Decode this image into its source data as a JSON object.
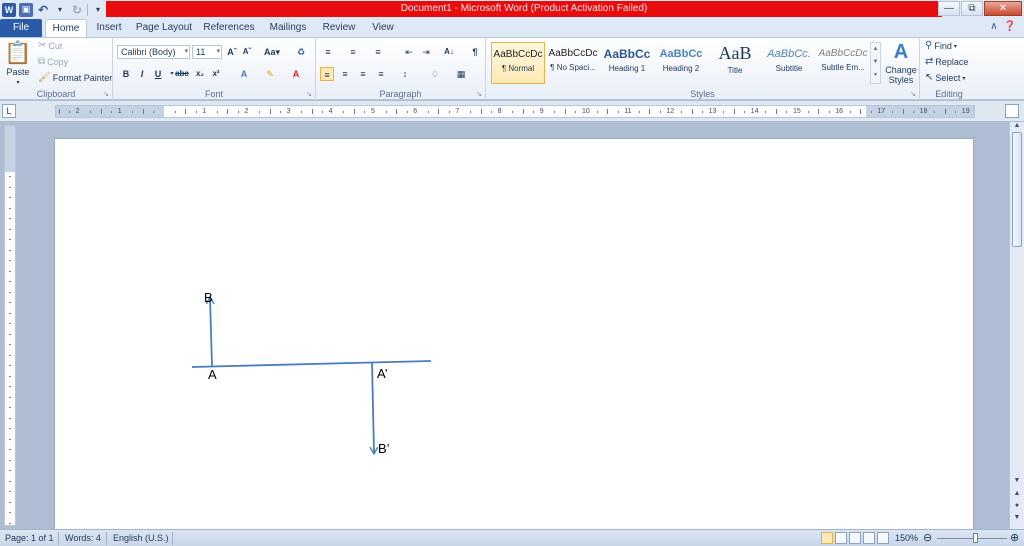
{
  "window": {
    "title": "Document1 - Microsoft Word (Product Activation Failed)",
    "controls": {
      "minimize": "—",
      "restore": "⧉",
      "close": "✕"
    }
  },
  "qat": {
    "app_letter": "W"
  },
  "tabs": [
    "File",
    "Home",
    "Insert",
    "Page Layout",
    "References",
    "Mailings",
    "Review",
    "View"
  ],
  "ribbon": {
    "clipboard": {
      "label": "Clipboard",
      "paste": "Paste",
      "cut": "Cut",
      "copy": "Copy",
      "format_painter": "Format Painter"
    },
    "font": {
      "label": "Font",
      "font_name": "Calibri (Body)",
      "font_size": "11"
    },
    "paragraph": {
      "label": "Paragraph"
    },
    "styles": {
      "label": "Styles",
      "items": [
        {
          "sample": "AaBbCcDc",
          "name": "¶ Normal"
        },
        {
          "sample": "AaBbCcDc",
          "name": "¶ No Spaci..."
        },
        {
          "sample": "AaBbCc",
          "name": "Heading 1"
        },
        {
          "sample": "AaBbCc",
          "name": "Heading 2"
        },
        {
          "sample": "AaB",
          "name": "Title"
        },
        {
          "sample": "AaBbCc.",
          "name": "Subtitle"
        },
        {
          "sample": "AaBbCcDc",
          "name": "Subtle Em..."
        }
      ],
      "change_styles": "Change Styles"
    },
    "editing": {
      "label": "Editing",
      "find": "Find",
      "replace": "Replace",
      "select": "Select"
    }
  },
  "ruler": {
    "tab_selector": "L",
    "numbers": [
      "2",
      "1",
      "1",
      "1",
      "2",
      "3",
      "4",
      "5",
      "6",
      "7",
      "8",
      "9",
      "10",
      "11",
      "12",
      "13",
      "14",
      "15",
      "16",
      "17",
      "18",
      "19"
    ]
  },
  "document": {
    "labels": {
      "B": "B",
      "A": "A",
      "A_prime": "A’",
      "B_prime": "B’"
    }
  },
  "statusbar": {
    "page": "Page: 1 of 1",
    "words": "Words: 4",
    "language": "English (U.S.)",
    "zoom": "150%"
  }
}
